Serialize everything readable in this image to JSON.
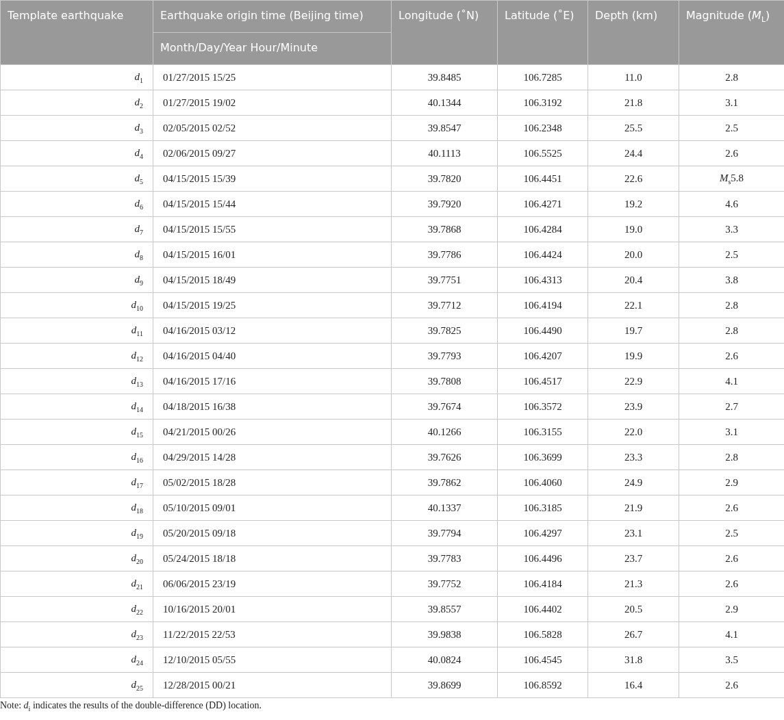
{
  "table": {
    "columns": [
      {
        "label": "Template earthquake"
      },
      {
        "label": "Earthquake origin time (Beijing time)",
        "sublabel": "Month/Day/Year Hour/Minute"
      },
      {
        "label": "Longitude (˚N)"
      },
      {
        "label": "Latitude (˚E)"
      },
      {
        "label": "Depth (km)"
      },
      {
        "label": "Magnitude (*M*$_{L}$)"
      }
    ],
    "rows": [
      [
        "*d*$_{1}$",
        "01/27/2015 15/25",
        "39.8485",
        "106.7285",
        "11.0",
        "2.8"
      ],
      [
        "*d*$_{2}$",
        "01/27/2015 19/02",
        "40.1344",
        "106.3192",
        "21.8",
        "3.1"
      ],
      [
        "*d*$_{3}$",
        "02/05/2015 02/52",
        "39.8547",
        "106.2348",
        "25.5",
        "2.5"
      ],
      [
        "*d*$_{4}$",
        "02/06/2015 09/27",
        "40.1113",
        "106.5525",
        "24.4",
        "2.6"
      ],
      [
        "*d*$_{5}$",
        "04/15/2015 15/39",
        "39.7820",
        "106.4451",
        "22.6",
        "*M*$_{s}$5.8"
      ],
      [
        "*d*$_{6}$",
        "04/15/2015 15/44",
        "39.7920",
        "106.4271",
        "19.2",
        "4.6"
      ],
      [
        "*d*$_{7}$",
        "04/15/2015 15/55",
        "39.7868",
        "106.4284",
        "19.0",
        "3.3"
      ],
      [
        "*d*$_{8}$",
        "04/15/2015 16/01",
        "39.7786",
        "106.4424",
        "20.0",
        "2.5"
      ],
      [
        "*d*$_{9}$",
        "04/15/2015 18/49",
        "39.7751",
        "106.4313",
        "20.4",
        "3.8"
      ],
      [
        "*d*$_{10}$",
        "04/15/2015 19/25",
        "39.7712",
        "106.4194",
        "22.1",
        "2.8"
      ],
      [
        "*d*$_{11}$",
        "04/16/2015 03/12",
        "39.7825",
        "106.4490",
        "19.7",
        "2.8"
      ],
      [
        "*d*$_{12}$",
        "04/16/2015 04/40",
        "39.7793",
        "106.4207",
        "19.9",
        "2.6"
      ],
      [
        "*d*$_{13}$",
        "04/16/2015 17/16",
        "39.7808",
        "106.4517",
        "22.9",
        "4.1"
      ],
      [
        "*d*$_{14}$",
        "04/18/2015 16/38",
        "39.7674",
        "106.3572",
        "23.9",
        "2.7"
      ],
      [
        "*d*$_{15}$",
        "04/21/2015 00/26",
        "40.1266",
        "106.3155",
        "22.0",
        "3.1"
      ],
      [
        "*d*$_{16}$",
        "04/29/2015 14/28",
        "39.7626",
        "106.3699",
        "23.3",
        "2.8"
      ],
      [
        "*d*$_{17}$",
        "05/02/2015 18/28",
        "39.7862",
        "106.4060",
        "24.9",
        "2.9"
      ],
      [
        "*d*$_{18}$",
        "05/10/2015 09/01",
        "40.1337",
        "106.3185",
        "21.9",
        "2.6"
      ],
      [
        "*d*$_{19}$",
        "05/20/2015 09/18",
        "39.7794",
        "106.4297",
        "23.1",
        "2.5"
      ],
      [
        "*d*$_{20}$",
        "05/24/2015 18/18",
        "39.7783",
        "106.4496",
        "23.7",
        "2.6"
      ],
      [
        "*d*$_{21}$",
        "06/06/2015 23/19",
        "39.7752",
        "106.4184",
        "21.3",
        "2.6"
      ],
      [
        "*d*$_{22}$",
        "10/16/2015 20/01",
        "39.8557",
        "106.4402",
        "20.5",
        "2.9"
      ],
      [
        "*d*$_{23}$",
        "11/22/2015 22/53",
        "39.9838",
        "106.5828",
        "26.7",
        "4.1"
      ],
      [
        "*d*$_{24}$",
        "12/10/2015 05/55",
        "40.0824",
        "106.4545",
        "31.8",
        "3.5"
      ],
      [
        "*d*$_{25}$",
        "12/28/2015 00/21",
        "39.8699",
        "106.8592",
        "16.4",
        "2.6"
      ]
    ]
  },
  "note": "Note: *d*$_{i}$ indicates the results of the double-difference (DD) location."
}
